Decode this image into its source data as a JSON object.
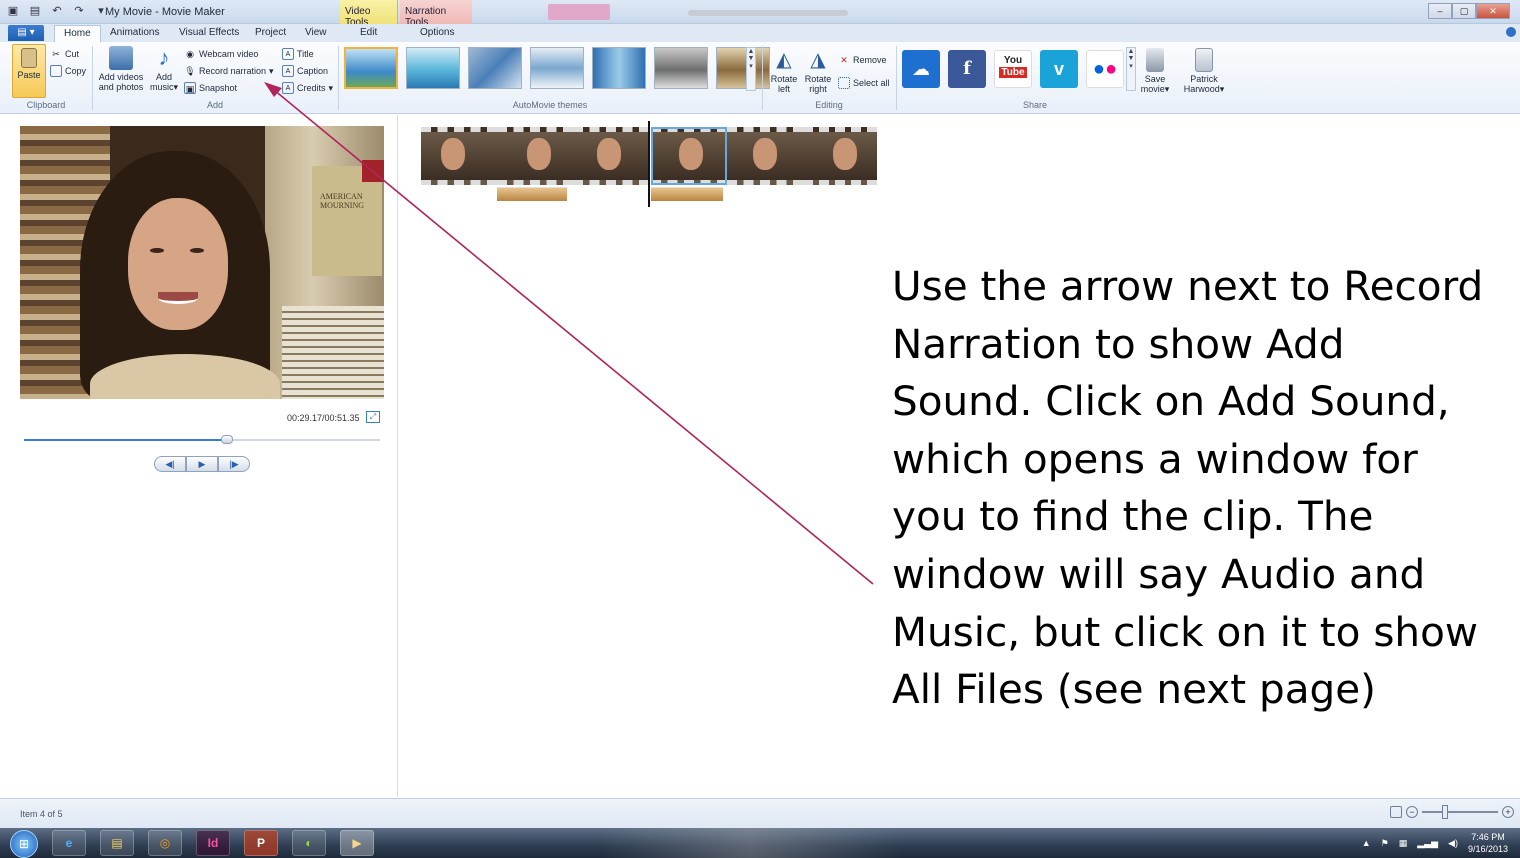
{
  "window": {
    "title": "My Movie - Movie Maker",
    "context_tabs": [
      "Video Tools",
      "Narration Tools"
    ]
  },
  "tabs": [
    "Home",
    "Animations",
    "Visual Effects",
    "Project",
    "View",
    "Edit",
    "Options"
  ],
  "active_tab": "Home",
  "ribbon": {
    "clipboard": {
      "label": "Clipboard",
      "paste": "Paste",
      "cut": "Cut",
      "copy": "Copy"
    },
    "add": {
      "label": "Add",
      "add_videos": [
        "Add videos",
        "and photos"
      ],
      "add_music": [
        "Add",
        "music"
      ],
      "webcam_video": "Webcam video",
      "record_narration": "Record narration",
      "snapshot": "Snapshot",
      "title": "Title",
      "caption": "Caption",
      "credits": "Credits"
    },
    "themes": {
      "label": "AutoMovie themes"
    },
    "editing": {
      "label": "Editing",
      "rotate_left": [
        "Rotate",
        "left"
      ],
      "rotate_right": [
        "Rotate",
        "right"
      ],
      "remove": "Remove",
      "select_all": "Select all"
    },
    "share": {
      "label": "Share",
      "save_movie": [
        "Save",
        "movie"
      ],
      "user": [
        "Patrick",
        "Harwood"
      ]
    }
  },
  "preview": {
    "timecode": "00:29.17/00:51.35",
    "seek_progress": 0.57,
    "book_cover_text": [
      "AMERICAN",
      "MOURNING"
    ]
  },
  "instructions": "Use the arrow next to Record Narration to show Add Sound. Click on Add Sound, which opens a window for you to find the clip. The window will say Audio and Music, but click on it to show All Files (see next page)",
  "status": {
    "item": "Item 4 of 5"
  },
  "taskbar": {
    "time": "7:46 PM",
    "date": "9/16/2013"
  },
  "colors": {
    "arrow": "#b0245a",
    "accent": "#3a7bd5"
  }
}
